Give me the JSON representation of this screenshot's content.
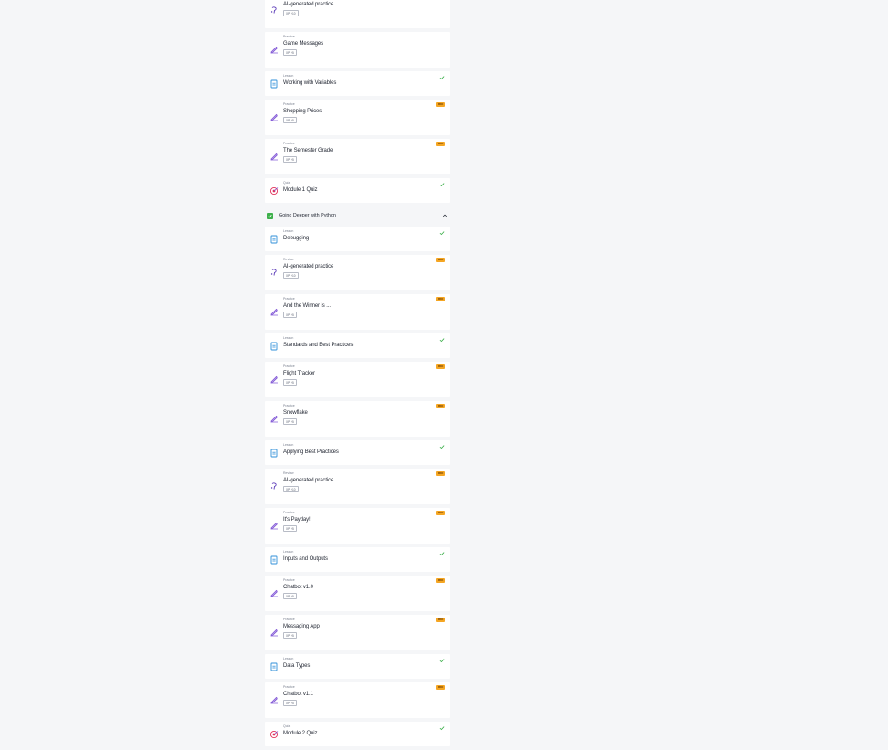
{
  "colors": {
    "lesson_icon": "#2f8fd8",
    "practice_icon": "#7b4fd4",
    "review_icon": "#5b3bb8",
    "quiz_icon": "#e2325a",
    "check": "#3db04b",
    "pro_badge": "#f5a623"
  },
  "items": [
    {
      "type": "review",
      "kind": "",
      "title": "AI-generated practice",
      "xp": "XP +10",
      "pro": "",
      "done": false
    },
    {
      "type": "practice",
      "kind": "Practice",
      "title": "Game Messages",
      "xp": "XP +5",
      "pro": "",
      "done": false
    },
    {
      "type": "lesson",
      "kind": "Lesson",
      "title": "Working with Variables",
      "xp": "",
      "pro": "",
      "done": true
    },
    {
      "type": "practice",
      "kind": "Practice",
      "title": "Shopping Prices",
      "xp": "XP +5",
      "pro": "PRO",
      "done": false
    },
    {
      "type": "practice",
      "kind": "Practice",
      "title": "The Semester Grade",
      "xp": "XP +5",
      "pro": "PRO",
      "done": false
    },
    {
      "type": "quiz",
      "kind": "Quiz",
      "title": "Module 1 Quiz",
      "xp": "",
      "pro": "",
      "done": true
    }
  ],
  "module2": {
    "title": "Going Deeper with Python",
    "chevron": "chevron-up-icon"
  },
  "items2": [
    {
      "type": "lesson",
      "kind": "Lesson",
      "title": "Debugging",
      "xp": "",
      "pro": "",
      "done": true
    },
    {
      "type": "review",
      "kind": "Review",
      "title": "AI-generated practice",
      "xp": "XP +10",
      "pro": "PRO",
      "done": false
    },
    {
      "type": "practice",
      "kind": "Practice",
      "title": "And the Winner is ...",
      "xp": "XP +5",
      "pro": "PRO",
      "done": false
    },
    {
      "type": "lesson",
      "kind": "Lesson",
      "title": "Standards and Best Practices",
      "xp": "",
      "pro": "",
      "done": true
    },
    {
      "type": "practice",
      "kind": "Practice",
      "title": "Flight Tracker",
      "xp": "XP +5",
      "pro": "PRO",
      "done": false
    },
    {
      "type": "practice",
      "kind": "Practice",
      "title": "Snowflake",
      "xp": "XP +5",
      "pro": "PRO",
      "done": false
    },
    {
      "type": "lesson",
      "kind": "Lesson",
      "title": "Applying Best Practices",
      "xp": "",
      "pro": "",
      "done": true
    },
    {
      "type": "review",
      "kind": "Review",
      "title": "AI-generated practice",
      "xp": "XP +10",
      "pro": "PRO",
      "done": false
    },
    {
      "type": "practice",
      "kind": "Practice",
      "title": "It's Payday!",
      "xp": "XP +5",
      "pro": "PRO",
      "done": false
    },
    {
      "type": "lesson",
      "kind": "Lesson",
      "title": "Inputs and Outputs",
      "xp": "",
      "pro": "",
      "done": true
    },
    {
      "type": "practice",
      "kind": "Practice",
      "title": "Chatbot v1.0",
      "xp": "XP +5",
      "pro": "PRO",
      "done": false
    },
    {
      "type": "practice",
      "kind": "Practice",
      "title": "Messaging App",
      "xp": "XP +5",
      "pro": "PRO",
      "done": false
    },
    {
      "type": "lesson",
      "kind": "Lesson",
      "title": "Data Types",
      "xp": "",
      "pro": "",
      "done": true
    },
    {
      "type": "practice",
      "kind": "Practice",
      "title": "Chatbot v1.1",
      "xp": "XP +5",
      "pro": "PRO",
      "done": false
    },
    {
      "type": "quiz",
      "kind": "Quiz",
      "title": "Module 2 Quiz",
      "xp": "",
      "pro": "",
      "done": true
    }
  ]
}
